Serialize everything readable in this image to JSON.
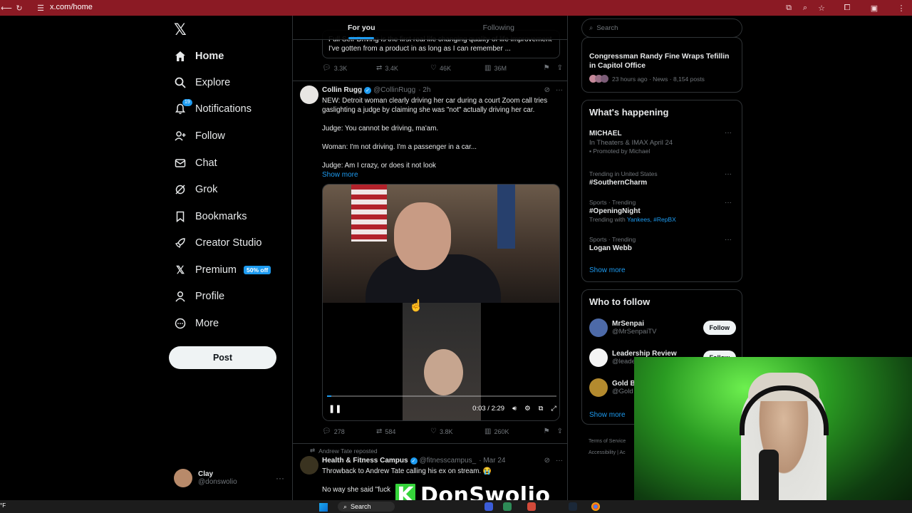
{
  "browser": {
    "url": "x.com/home"
  },
  "nav": {
    "items": [
      {
        "label": "Home"
      },
      {
        "label": "Explore"
      },
      {
        "label": "Notifications",
        "badge": "19"
      },
      {
        "label": "Follow"
      },
      {
        "label": "Chat"
      },
      {
        "label": "Grok"
      },
      {
        "label": "Bookmarks"
      },
      {
        "label": "Creator Studio"
      },
      {
        "label": "Premium",
        "badge": "50% off"
      },
      {
        "label": "Profile"
      },
      {
        "label": "More"
      }
    ],
    "post_label": "Post",
    "profile": {
      "name": "Clay",
      "handle": "@donswolio"
    }
  },
  "tabs": [
    {
      "label": "For you"
    },
    {
      "label": "Following"
    }
  ],
  "quoted_tweet": {
    "text_line1": "Full Self-Driving is the first real life changing quality of life improvement",
    "text_line2": "I've gotten from a product in as long as I can remember ..."
  },
  "tweet0_actions": {
    "replies": "3.3K",
    "reposts": "3.4K",
    "likes": "46K",
    "views": "36M"
  },
  "tweet1": {
    "name": "Collin Rugg",
    "handle": "@CollinRugg",
    "time": "· 2h",
    "p1": "NEW: Detroit woman clearly driving her car during a court Zoom call tries gaslighting a judge by claiming she was \"not\" actually driving her car.",
    "p2": "Judge: You cannot be driving, ma'am.",
    "p3": "Woman: I'm not driving. I'm a passenger in a car...",
    "p4": "Judge: Am I crazy, or does it not look",
    "show_more": "Show more",
    "video_time": "0:03 / 2:29",
    "video_progress": 0.02,
    "replies": "278",
    "reposts": "584",
    "likes": "3.8K",
    "views": "260K"
  },
  "tweet2": {
    "repost_by": "Andrew Tate reposted",
    "name": "Health & Fitness Campus",
    "handle": "@fitnesscampus_",
    "time": "· Mar 24",
    "p1": "Throwback to Andrew Tate calling his ex on stream. 😭",
    "p2": "No way she said \"fuck"
  },
  "right": {
    "search_placeholder": "Search",
    "news": {
      "title": "Congressman Randy Fine Wraps Tefillin in Capitol Office",
      "meta": "23 hours ago · News · 8,154 posts"
    },
    "happening": {
      "title": "What's happening",
      "trends": [
        {
          "meta": "",
          "title": "MICHAEL",
          "sub": "In Theaters & IMAX April 24",
          "sub2": "Promoted by Michael"
        },
        {
          "meta": "Trending in United States",
          "title": "#SouthernCharm",
          "sub": "",
          "sub2": ""
        },
        {
          "meta": "Sports · Trending",
          "title": "#OpeningNight",
          "sub": "Trending with",
          "sub2": "Yankees, #RepBX"
        },
        {
          "meta": "Sports · Trending",
          "title": "Logan Webb",
          "sub": "",
          "sub2": ""
        }
      ],
      "show_more": "Show more"
    },
    "who": {
      "title": "Who to follow",
      "users": [
        {
          "name": "MrSenpai",
          "handle": "@MrSenpaiTV",
          "button": "Follow"
        },
        {
          "name": "Leadership Review",
          "handle": "@leade",
          "button": "Follow"
        },
        {
          "name": "Gold Bo",
          "handle": "@Gold",
          "button": ""
        }
      ],
      "show_more": "Show more"
    },
    "footer": {
      "line1": "Terms of Service",
      "line2": "Accessibility  |  Ac"
    }
  },
  "overlay": {
    "k": "K",
    "name": "DonSwolio"
  },
  "taskbar": {
    "search": "Search",
    "weather": "°F"
  }
}
